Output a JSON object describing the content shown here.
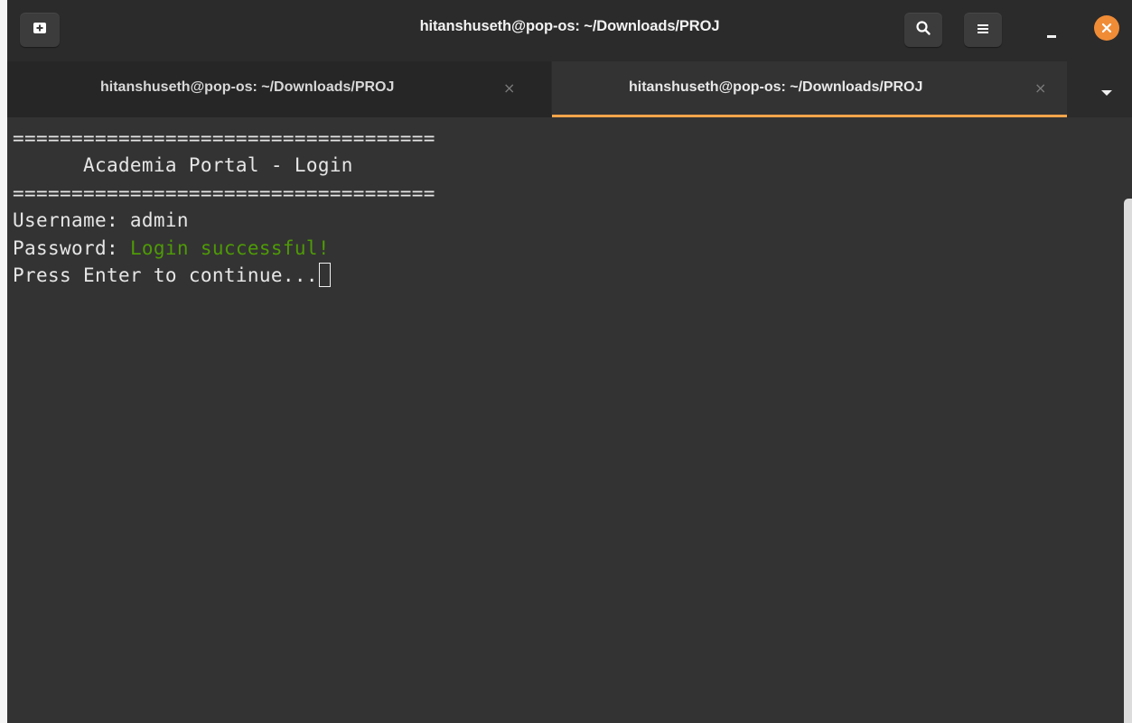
{
  "window": {
    "title": "hitanshuseth@pop-os: ~/Downloads/PROJ"
  },
  "header": {
    "icons": {
      "new_tab": "new-tab-icon",
      "search": "search-icon",
      "menu": "hamburger-menu-icon",
      "minimize": "minimize-icon",
      "close": "close-icon"
    }
  },
  "tabs": [
    {
      "label": "hitanshuseth@pop-os: ~/Downloads/PROJ",
      "close": "×",
      "active": false
    },
    {
      "label": "hitanshuseth@pop-os: ~/Downloads/PROJ",
      "close": "×",
      "active": true
    }
  ],
  "terminal": {
    "lines": [
      {
        "text": "===================================="
      },
      {
        "text": "      Academia Portal - Login"
      },
      {
        "text": "===================================="
      },
      {
        "text": "Username: admin"
      },
      {
        "prefix": "Password: ",
        "highlight": "Login successful!"
      },
      {
        "text": "Press Enter to continue..."
      }
    ]
  },
  "colors": {
    "accent": "#f5a54a",
    "close_button": "#f08c36",
    "success_text": "#4e9a06",
    "terminal_bg": "#333333"
  }
}
